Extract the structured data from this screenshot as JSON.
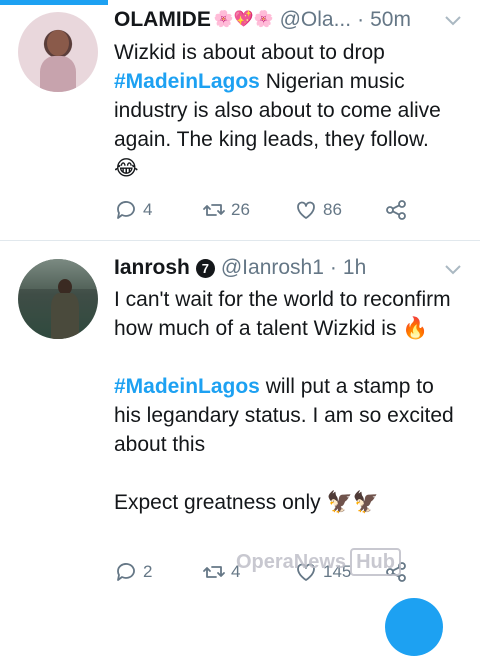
{
  "tweets": [
    {
      "name": "OLAMIDE",
      "name_emoji": "🌸💖🌸",
      "handle": "@Ola...",
      "dot": "·",
      "time": "50m",
      "text_before": "Wizkid is about about to drop ",
      "hashtag": "#MadeinLagos",
      "text_after": " Nigerian music industry is also about to come alive again. The king leads, they follow.",
      "emoji_line": "😂",
      "replies": "4",
      "retweets": "26",
      "likes": "86"
    },
    {
      "name": "Ianrosh",
      "badge": "7",
      "handle": "@Ianrosh1",
      "dot": "·",
      "time": "1h",
      "para1": "I can't wait for the world to reconfirm how much of a talent Wizkid is 🔥",
      "hashtag": "#MadeinLagos",
      "para2_after": " will put a stamp to his legandary status. I am so excited about this",
      "para3": "Expect greatness only 🦅🦅",
      "replies": "2",
      "retweets": "4",
      "likes": "145"
    }
  ],
  "watermark": {
    "brand": "OperaNews",
    "hub": "Hub"
  },
  "colors": {
    "accent": "#1da1f2",
    "secondary_text": "#657786",
    "divider": "#e1e8ed"
  },
  "icons": [
    "reply-icon",
    "retweet-icon",
    "like-icon",
    "share-icon",
    "chevron-down-icon",
    "verified-badge-icon"
  ]
}
